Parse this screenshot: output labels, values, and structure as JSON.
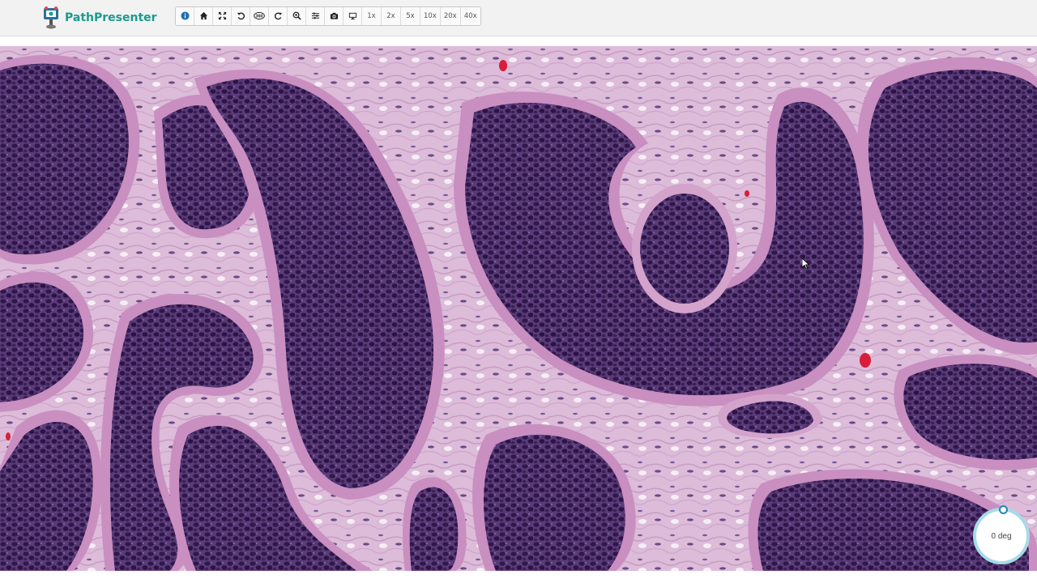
{
  "app": {
    "brand_name": "PathPresenter",
    "brand_color": "#1a9a8e"
  },
  "toolbar": {
    "buttons": [
      {
        "name": "info-icon",
        "tooltip": ""
      },
      {
        "name": "home-icon"
      },
      {
        "name": "fullscreen-icon"
      },
      {
        "name": "rotate-left-icon"
      },
      {
        "name": "rotate-360-icon",
        "label": "360"
      },
      {
        "name": "rotate-right-icon"
      },
      {
        "name": "zoom-in-icon"
      },
      {
        "name": "adjust-sliders-icon"
      },
      {
        "name": "camera-icon"
      },
      {
        "name": "monitor-icon"
      }
    ],
    "zoom_levels": [
      "1x",
      "2x",
      "5x",
      "10x",
      "20x",
      "40x"
    ],
    "accent": "#1f86b8"
  },
  "viewer": {
    "stain_colors": {
      "stroma": "#dcbcd9",
      "nuclei": "#4b2a63",
      "palisade": "#2f1848",
      "eosin": "#c98fc0",
      "rbc": "#d81e3a"
    }
  },
  "rotation": {
    "label": "0 deg",
    "ring_color": "#a6dbe8"
  }
}
